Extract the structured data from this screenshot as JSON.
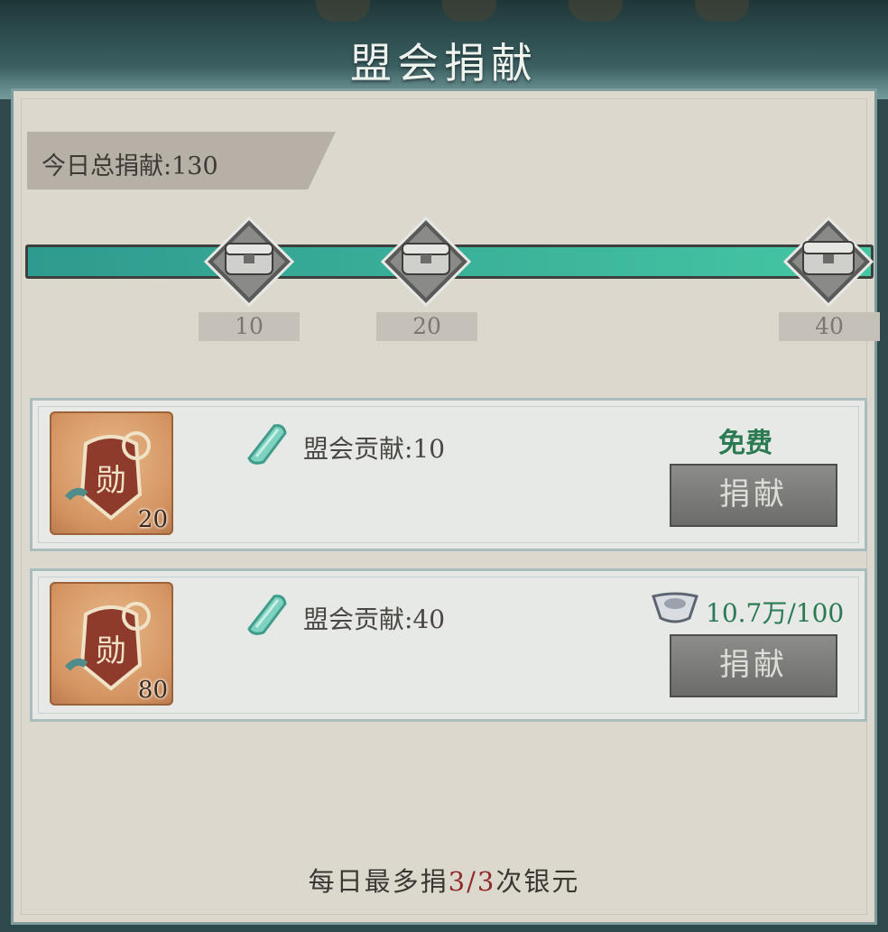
{
  "title": "盟会捐献",
  "total": {
    "label": "今日总捐献:130"
  },
  "progress": {
    "fill_fraction": 1.0,
    "milestones": [
      {
        "value": "10"
      },
      {
        "value": "20"
      },
      {
        "value": "40"
      }
    ]
  },
  "donations": [
    {
      "item_count": "20",
      "reward": "盟会贡献:10",
      "cost": "免费",
      "button": "捐献"
    },
    {
      "item_count": "80",
      "reward": "盟会贡献:40",
      "cost": "10.7万/100",
      "button": "捐献"
    }
  ],
  "footer": {
    "prefix": "每日最多捐",
    "count": "3/3",
    "suffix": "次银元"
  },
  "colors": {
    "accent_teal": "#45c7a3",
    "cost_green": "#2b7a53",
    "highlight_red": "#8e2a2a"
  },
  "icons": {
    "milestone": "treasure-chest-icon",
    "item": "merit-medal-icon",
    "reward": "jade-token-icon",
    "currency": "silver-ingot-icon"
  }
}
